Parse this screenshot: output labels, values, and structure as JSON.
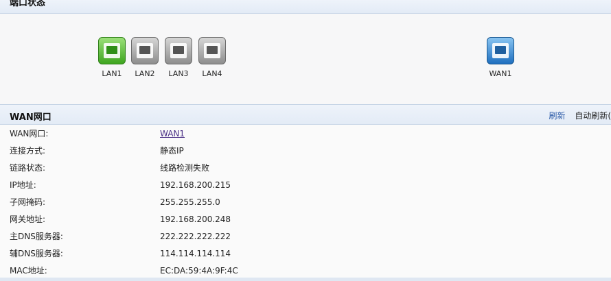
{
  "port_status": {
    "title": "端口状态",
    "ports": [
      {
        "label": "LAN1",
        "state": "active",
        "color": "#3ea51f"
      },
      {
        "label": "LAN2",
        "state": "inactive",
        "color": "#8d8d8d"
      },
      {
        "label": "LAN3",
        "state": "inactive",
        "color": "#8d8d8d"
      },
      {
        "label": "LAN4",
        "state": "inactive",
        "color": "#8d8d8d"
      }
    ],
    "wan": {
      "label": "WAN1",
      "state": "active",
      "color": "#1f6fbf"
    }
  },
  "wan_section": {
    "title": "WAN网口",
    "refresh_label": "刷新",
    "auto_refresh_label": "自动刷新(",
    "rows": [
      {
        "label": "WAN网口:",
        "value": "WAN1"
      },
      {
        "label": "连接方式:",
        "value": "静态IP"
      },
      {
        "label": "链路状态:",
        "value": "线路检测失败"
      },
      {
        "label": "IP地址:",
        "value": "192.168.200.215"
      },
      {
        "label": "子网掩码:",
        "value": "255.255.255.0"
      },
      {
        "label": "网关地址:",
        "value": "192.168.200.248"
      },
      {
        "label": "主DNS服务器:",
        "value": "222.222.222.222"
      },
      {
        "label": "辅DNS服务器:",
        "value": "114.114.114.114"
      },
      {
        "label": "MAC地址:",
        "value": "EC:DA:59:4A:9F:4C"
      }
    ]
  }
}
